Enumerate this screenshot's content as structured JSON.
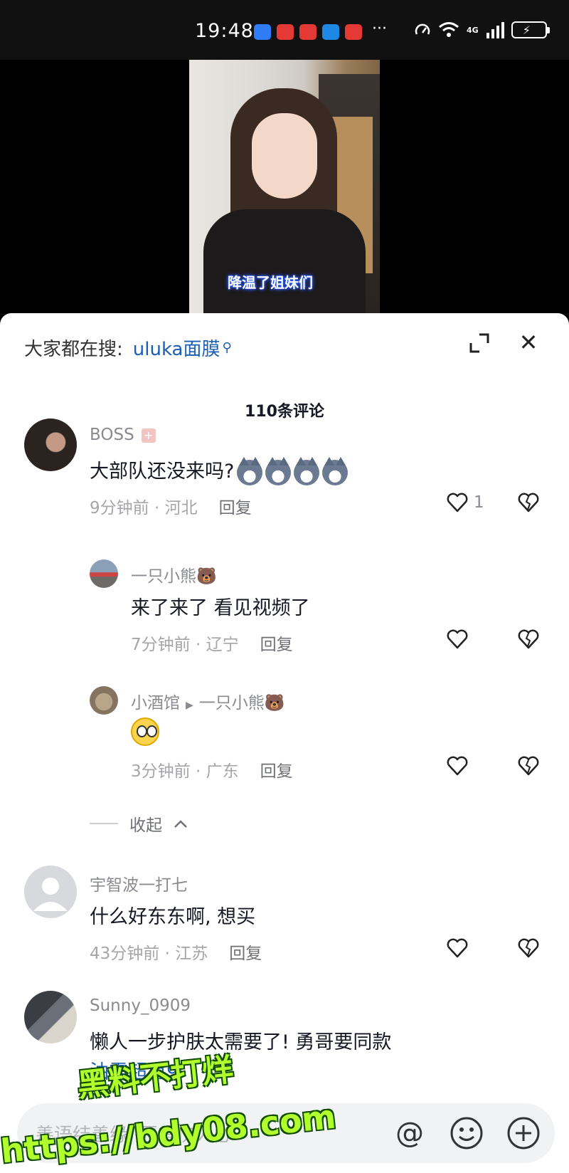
{
  "status_bar": {
    "time": "19:48",
    "more": "···",
    "network": "4G"
  },
  "video": {
    "caption": "降温了姐妹们"
  },
  "sheet": {
    "search_prefix": "大家都在搜:",
    "search_term": "uluka面膜",
    "comment_count": "110条评论"
  },
  "comments": [
    {
      "author": "BOSS",
      "text": "大部队还没来吗?",
      "time": "9分钟前",
      "region": "河北",
      "reply_label": "回复",
      "likes": "1"
    },
    {
      "author": "一只小熊🐻",
      "text": "来了来了 看见视频了",
      "time": "7分钟前",
      "region": "辽宁",
      "reply_label": "回复"
    },
    {
      "author": "小酒馆",
      "reply_to": "一只小熊🐻",
      "time": "3分钟前",
      "region": "广东",
      "reply_label": "回复"
    },
    {
      "author": "宇智波一打七",
      "text": "什么好东东啊, 想买",
      "time": "43分钟前",
      "region": "江苏",
      "reply_label": "回复"
    },
    {
      "author": "Sunny_0909",
      "text": "懒人一步护肤太需要了! 勇哥要同款",
      "link_text": "油霜超重9"
    }
  ],
  "collapse_label": "收起",
  "input": {
    "placeholder": "善语结善缘, 恶言伤人心"
  },
  "watermark": {
    "line1": "黑料不打烊",
    "line2": "https://bdy08.com"
  },
  "colors": {
    "link": "#1a5fb4",
    "watermark": "#b2ff2e"
  }
}
